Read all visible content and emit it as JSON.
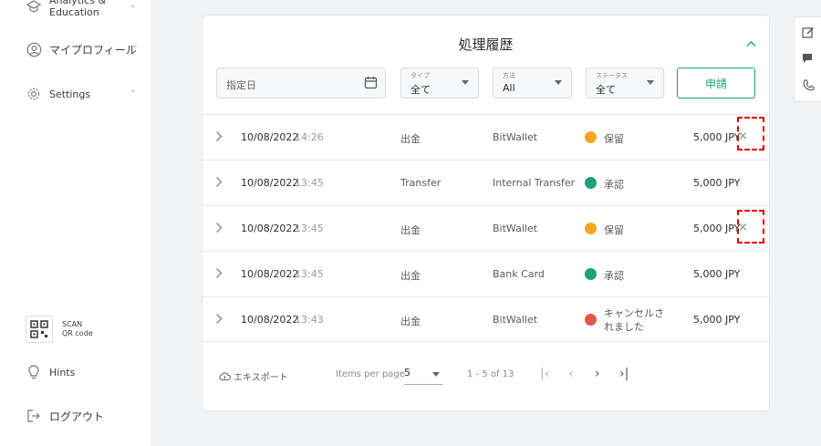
{
  "sidebar": {
    "items": [
      {
        "label": "Analytics &\nEducation",
        "icon": "education-icon"
      },
      {
        "label": "マイプロフィール",
        "icon": "profile-icon"
      },
      {
        "label": "Settings",
        "icon": "gear-icon"
      }
    ],
    "qr": {
      "line1": "SCAN",
      "line2": "QR code",
      "icon": "qr-code-icon"
    },
    "hints": {
      "label": "Hints",
      "icon": "lightbulb-icon"
    },
    "logout": {
      "label": "ログアウト",
      "icon": "logout-icon"
    }
  },
  "history": {
    "title": "処理履歴",
    "filters": {
      "date": {
        "placeholder": "指定日"
      },
      "type": {
        "label": "タイプ",
        "value": "全て"
      },
      "method": {
        "label": "方法",
        "value": "All"
      },
      "status": {
        "label": "ステータス",
        "value": "全て"
      }
    },
    "apply_label": "申請",
    "rows": [
      {
        "date": "10/08/2022",
        "time": "14:26",
        "type": "出金",
        "method": "BitWallet",
        "status": "保留",
        "status_kind": "pending",
        "amount": "5,000 JPY",
        "cancel": "×"
      },
      {
        "date": "10/08/2022",
        "time": "13:45",
        "type": "Transfer",
        "method": "Internal Transfer",
        "status": "承認",
        "status_kind": "ok",
        "amount": "5,000 JPY",
        "cancel": ""
      },
      {
        "date": "10/08/2022",
        "time": "13:45",
        "type": "出金",
        "method": "BitWallet",
        "status": "保留",
        "status_kind": "pending",
        "amount": "5,000 JPY",
        "cancel": "×"
      },
      {
        "date": "10/08/2022",
        "time": "13:45",
        "type": "出金",
        "method": "Bank Card",
        "status": "承認",
        "status_kind": "ok",
        "amount": "5,000 JPY",
        "cancel": ""
      },
      {
        "date": "10/08/2022",
        "time": "13:43",
        "type": "出金",
        "method": "BitWallet",
        "status": "キャンセルされました",
        "status_kind": "cancel",
        "amount": "5,000 JPY",
        "cancel": ""
      }
    ],
    "footer": {
      "export_label": "エキスポート",
      "items_per_page_label": "Items per page",
      "items_per_page_value": "5",
      "range": "1 - 5 of 13",
      "pager": {
        "first": "|‹",
        "prev": "‹",
        "next": "›",
        "last": "›|"
      }
    }
  },
  "colors": {
    "accent": "#1aa37a",
    "pending": "#f5a623",
    "ok": "#1aa37a",
    "cancel": "#e2574c",
    "highlight": "#e00000"
  }
}
